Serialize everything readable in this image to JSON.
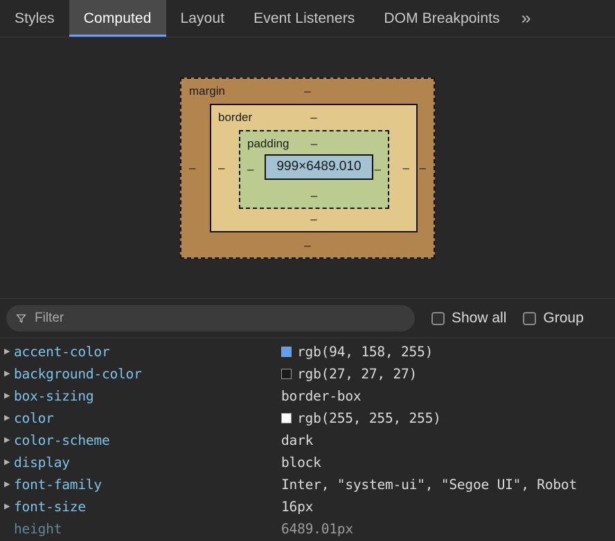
{
  "tabs": {
    "items": [
      {
        "label": "Styles",
        "selected": false
      },
      {
        "label": "Computed",
        "selected": true
      },
      {
        "label": "Layout",
        "selected": false
      },
      {
        "label": "Event Listeners",
        "selected": false
      },
      {
        "label": "DOM Breakpoints",
        "selected": false
      }
    ],
    "overflow_label": "»",
    "selected_underline_color": "#6b9eff"
  },
  "box_model": {
    "margin": {
      "label": "margin",
      "top": "–",
      "right": "–",
      "bottom": "–",
      "left": "–",
      "color": "#b2854e"
    },
    "border": {
      "label": "border",
      "top": "–",
      "right": "–",
      "bottom": "–",
      "left": "–",
      "color": "#e2c88a"
    },
    "padding": {
      "label": "padding",
      "top": "–",
      "right": "–",
      "bottom": "–",
      "left": "–",
      "color": "#bccb8f"
    },
    "content": {
      "dimensions": "999×6489.010",
      "color": "#a3c2d3"
    }
  },
  "filter": {
    "placeholder": "Filter",
    "value": "",
    "icon": "funnel-icon",
    "show_all": {
      "label": "Show all",
      "checked": false
    },
    "group": {
      "label": "Group",
      "checked": false
    }
  },
  "properties": [
    {
      "name": "accent-color",
      "value": "rgb(94, 158, 255)",
      "swatch": "#5e9eff",
      "expandable": true,
      "dimmed": false
    },
    {
      "name": "background-color",
      "value": "rgb(27, 27, 27)",
      "swatch": "#1b1b1b",
      "expandable": true,
      "dimmed": false
    },
    {
      "name": "box-sizing",
      "value": "border-box",
      "swatch": null,
      "expandable": true,
      "dimmed": false
    },
    {
      "name": "color",
      "value": "rgb(255, 255, 255)",
      "swatch": "#ffffff",
      "expandable": true,
      "dimmed": false
    },
    {
      "name": "color-scheme",
      "value": "dark",
      "swatch": null,
      "expandable": true,
      "dimmed": false
    },
    {
      "name": "display",
      "value": "block",
      "swatch": null,
      "expandable": true,
      "dimmed": false
    },
    {
      "name": "font-family",
      "value": "Inter, \"system-ui\", \"Segoe UI\", Robot",
      "swatch": null,
      "expandable": true,
      "dimmed": false
    },
    {
      "name": "font-size",
      "value": "16px",
      "swatch": null,
      "expandable": true,
      "dimmed": false
    },
    {
      "name": "height",
      "value": "6489.01px",
      "swatch": null,
      "expandable": false,
      "dimmed": true
    }
  ]
}
